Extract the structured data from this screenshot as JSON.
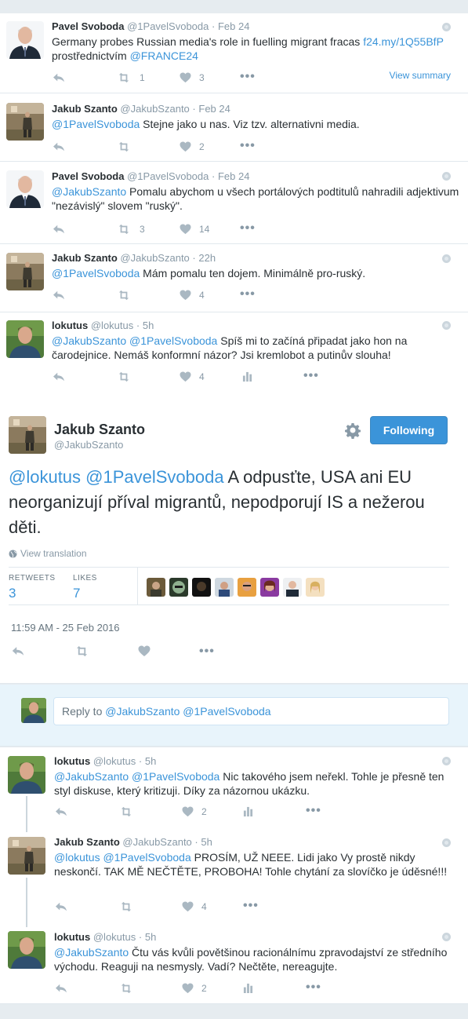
{
  "tweets": [
    {
      "fullname": "Pavel Svoboda",
      "username": "@1PavelSvoboda",
      "time": "Feb 24",
      "text_plain": "Germany probes Russian media's role in fuelling migrant fracas ",
      "link": "f24.my/1Q55BfP",
      "text_line2": "prostřednictvím ",
      "mention": "@FRANCE24",
      "retweets": "1",
      "likes": "3",
      "view_summary": "View summary"
    },
    {
      "fullname": "Jakub Szanto",
      "username": "@JakubSzanto",
      "time": "Feb 24",
      "mention": "@1PavelSvoboda",
      "text": " Stejne jako u nas. Viz tzv. alternativni media.",
      "retweets": "",
      "likes": "2"
    },
    {
      "fullname": "Pavel Svoboda",
      "username": "@1PavelSvoboda",
      "time": "Feb 24",
      "mention": "@JakubSzanto",
      "text": " Pomalu abychom u všech portálových podtitulů nahradili adjektivum \"nezávislý\" slovem \"ruský\".",
      "retweets": "3",
      "likes": "14"
    },
    {
      "fullname": "Jakub Szanto",
      "username": "@JakubSzanto",
      "time": "22h",
      "mention": "@1PavelSvoboda",
      "text": " Mám pomalu ten dojem. Minimálně pro-ruský.",
      "retweets": "",
      "likes": "4"
    },
    {
      "fullname": "lokutus",
      "username": "@lokutus",
      "time": "5h",
      "mention": "@JakubSzanto @1PavelSvoboda",
      "text": " Spíš mi to začíná připadat jako hon na čarodejnice. Nemáš konformní názor? Jsi kremlobot a putinův slouha!",
      "retweets": "",
      "likes": "4"
    }
  ],
  "permalink": {
    "fullname": "Jakub Szanto",
    "username": "@JakubSzanto",
    "follow_label": "Following",
    "mention": "@lokutus @1PavelSvoboda",
    "text": " A odpusťte, USA ani EU neorganizují příval migrantů, nepodporují IS a nežerou děti.",
    "view_translation": "View translation",
    "retweets_label": "RETWEETS",
    "retweets": "3",
    "likes_label": "LIKES",
    "likes": "7",
    "timestamp": "11:59 AM - 25 Feb 2016"
  },
  "reply_box": {
    "prefix": "Reply to ",
    "mentions": "@JakubSzanto @1PavelSvoboda"
  },
  "replies": [
    {
      "fullname": "lokutus",
      "username": "@lokutus",
      "time": "5h",
      "mention": "@JakubSzanto @1PavelSvoboda",
      "text": " Nic takového jsem neřekl. Tohle je přesně ten styl diskuse, který kritizuji. Díky za názornou ukázku.",
      "likes": "2"
    },
    {
      "fullname": "Jakub Szanto",
      "username": "@JakubSzanto",
      "time": "5h",
      "mention": "@lokutus @1PavelSvoboda",
      "text": " PROSÍM, UŽ NEEE. Lidi jako Vy prostě nikdy neskončí. TAK MĚ NEČTĚTE, PROBOHA! Tohle chytání za slovíčko je úděsné!!!",
      "likes": "4"
    },
    {
      "fullname": "lokutus",
      "username": "@lokutus",
      "time": "5h",
      "mention": "@JakubSzanto",
      "text": " Čtu vás kvůli povětšinou racionálnímu zpravodajství ze středního východu. Reaguji na nesmysly. Vadí? Nečtěte, nereagujte.",
      "likes": "2"
    }
  ],
  "colors": {
    "accent": "#3b94d9",
    "text": "#292f33",
    "muted": "#8899a6"
  }
}
